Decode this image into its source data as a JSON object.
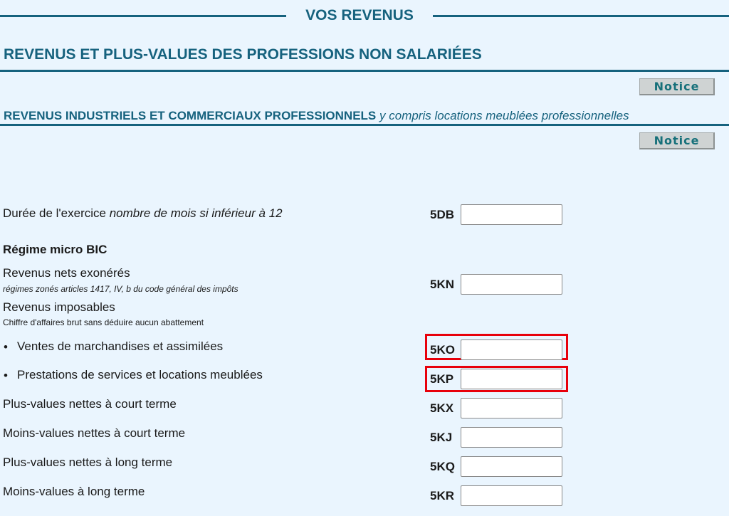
{
  "header": {
    "section_title": "VOS REVENUS",
    "subsection_title": "REVENUS ET PLUS-VALUES DES PROFESSIONS NON SALARIÉES"
  },
  "notice_buttons": [
    "Notice",
    "Notice"
  ],
  "ric_section": {
    "title_bold": "REVENUS INDUSTRIELS ET COMMERCIAUX PROFESSIONNELS",
    "title_italic": "y compris locations meublées professionnelles"
  },
  "form": {
    "duree": {
      "label": "Durée de l'exercice",
      "label_italic": "nombre de mois si inférieur à 12",
      "code": "5DB",
      "value": ""
    },
    "regime_title": "Régime micro BIC",
    "revenus_exoneres": {
      "label": "Revenus nets exonérés",
      "sublabel": "régimes zonés articles 1417, IV, b du code général des impôts",
      "code": "5KN",
      "value": ""
    },
    "revenus_imposables": {
      "label": "Revenus imposables",
      "sublabel": "Chiffre d'affaires brut sans déduire aucun abattement"
    },
    "bullet_glyph": "•",
    "ventes": {
      "label": "Ventes de marchandises et assimilées",
      "code": "5KO",
      "value": "",
      "highlighted": true
    },
    "prestations": {
      "label": "Prestations de services et locations meublées",
      "code": "5KP",
      "value": "",
      "highlighted": true
    },
    "pv_court": {
      "label": "Plus-values nettes à court terme",
      "code": "5KX",
      "value": ""
    },
    "mv_court": {
      "label": "Moins-values nettes à court terme",
      "code": "5KJ",
      "value": ""
    },
    "pv_long": {
      "label": "Plus-values nettes à long terme",
      "code": "5KQ",
      "value": ""
    },
    "mv_long": {
      "label": "Moins-values à long terme",
      "code": "5KR",
      "value": ""
    }
  },
  "colors": {
    "heading": "#16627e",
    "background": "#eaf5fe",
    "highlight": "#e8000b"
  }
}
